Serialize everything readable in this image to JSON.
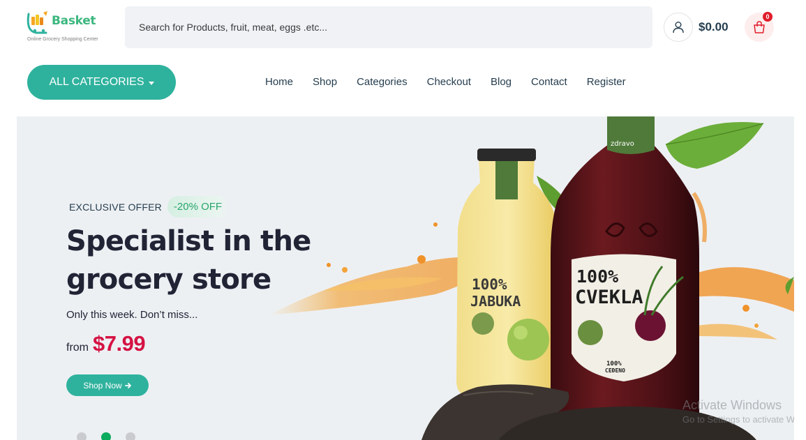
{
  "brand": {
    "name": "Basket",
    "tagline": "Online Grocery Shopping Center",
    "accent": "#3bb77e"
  },
  "search": {
    "placeholder": "Search for Products, fruit, meat, eggs .etc..."
  },
  "header": {
    "account_icon": "user-icon",
    "cart_total": "$0.00",
    "cart_icon": "shopping-bag-icon",
    "cart_count": "0"
  },
  "categories_button": {
    "label": "ALL CATEGORIES",
    "color": "#2fb29d"
  },
  "nav": {
    "items": [
      "Home",
      "Shop",
      "Categories",
      "Checkout",
      "Blog",
      "Contact",
      "Register"
    ]
  },
  "hero": {
    "offer_label": "EXCLUSIVE OFFER",
    "discount": "-20% OFF",
    "title_line1": "Specialist in the",
    "title_line2": "grocery store",
    "subtitle": "Only this week. Don’t miss...",
    "price_prefix": "from",
    "price": "$7.99",
    "price_color": "#d51243",
    "cta_label": "Shop Now",
    "slides": 3,
    "active_slide": 2,
    "product_back": {
      "line1": "100%",
      "line2": "JABUKA"
    },
    "product_front": {
      "brand": "zdravo",
      "line1": "100%",
      "line2": "CVEKLA",
      "footer1": "100%",
      "footer2": "CEĐENO"
    }
  },
  "watermark": {
    "line1": "Activate Windows",
    "line2": "Go to Settings to activate W"
  }
}
